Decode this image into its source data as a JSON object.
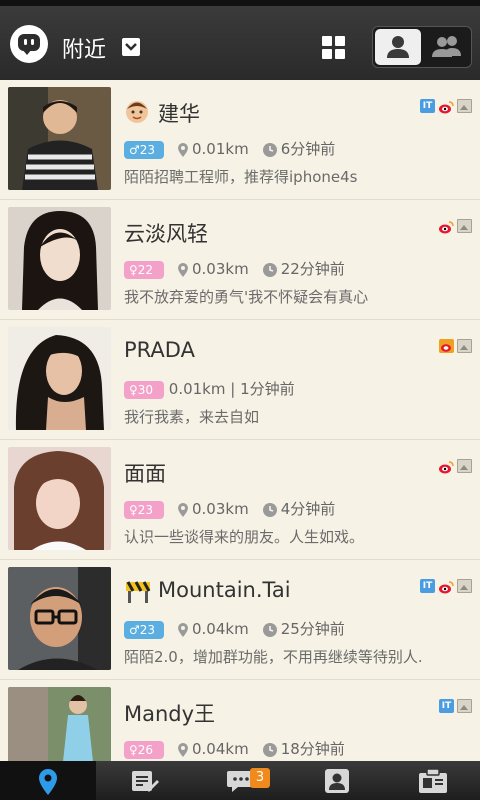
{
  "header": {
    "title": "附近",
    "icons": [
      "app-logo-icon",
      "dropdown-chevron-icon",
      "grid-view-icon",
      "single-user-icon",
      "group-users-icon"
    ]
  },
  "users": [
    {
      "name": "建华",
      "gender": "male",
      "age": "♂23",
      "distance": "0.01km",
      "time": "6分钟前",
      "status": "陌陌招聘工程师，推荐得iphone4s",
      "badges": [
        "IT",
        "weibo",
        "photo"
      ],
      "name_icon": "face-emoji-icon"
    },
    {
      "name": "云淡风轻",
      "gender": "female",
      "age": "♀22",
      "distance": "0.03km",
      "time": "22分钟前",
      "status": "我不放弃爱的勇气'我不怀疑会有真心",
      "badges": [
        "weibo",
        "photo"
      ],
      "name_icon": ""
    },
    {
      "name": "PRADA",
      "gender": "female",
      "age": "♀30",
      "distance_time": "0.01km | 1分钟前",
      "status": "我行我素，来去自如",
      "badges": [
        "weibo-sq",
        "photo"
      ],
      "name_icon": ""
    },
    {
      "name": "面面",
      "gender": "female",
      "age": "♀23",
      "distance": "0.03km",
      "time": "4分钟前",
      "status": "认识一些谈得来的朋友。人生如戏。",
      "badges": [
        "weibo",
        "photo"
      ],
      "name_icon": ""
    },
    {
      "name": "Mountain.Tai",
      "gender": "male",
      "age": "♂23",
      "distance": "0.04km",
      "time": "25分钟前",
      "status": "陌陌2.0，增加群功能，不用再继续等待别人.",
      "badges": [
        "IT",
        "weibo",
        "photo"
      ],
      "name_icon": "construction-barrier-icon"
    },
    {
      "name": "Mandy王",
      "gender": "female",
      "age": "♀26",
      "distance": "0.04km",
      "time": "18分钟前",
      "status": "",
      "badges": [
        "IT",
        "photo"
      ],
      "name_icon": ""
    }
  ],
  "tabbar": {
    "tabs": [
      "nearby-location-icon",
      "notes-edit-icon",
      "messages-chat-icon",
      "contacts-icon",
      "profile-card-icon"
    ],
    "messages_badge": "3"
  },
  "colors": {
    "male": "#5aaee0",
    "female": "#f3a1c8",
    "badge": "#f08a1c",
    "weibo": "#e6162d",
    "it": "#4a9de0"
  }
}
